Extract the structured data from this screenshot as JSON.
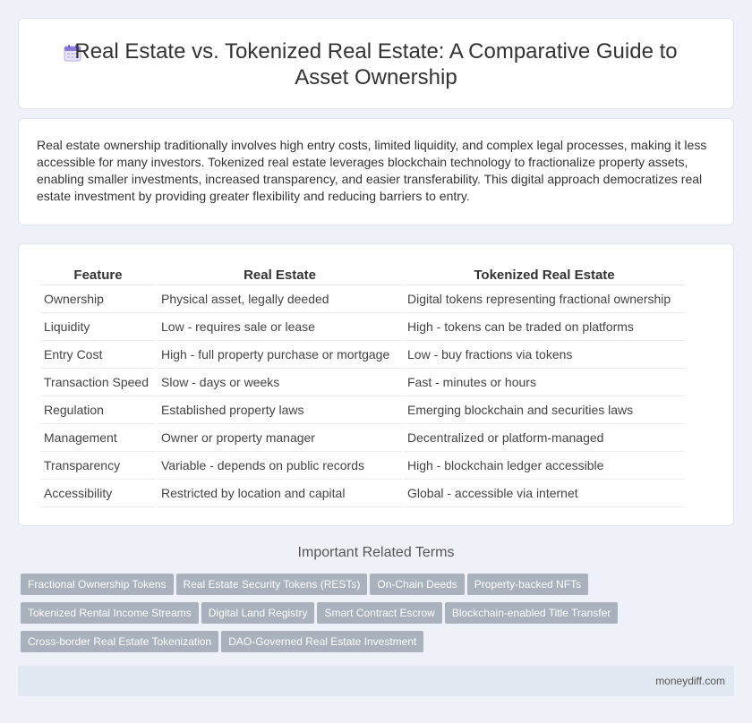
{
  "header": {
    "title": "Real Estate vs. Tokenized Real Estate: A Comparative Guide to Asset Ownership",
    "icon": "calendar-icon"
  },
  "intro": {
    "text": "Real estate ownership traditionally involves high entry costs, limited liquidity, and complex legal processes, making it less accessible for many investors. Tokenized real estate leverages blockchain technology to fractionalize property assets, enabling smaller investments, increased transparency, and easier transferability. This digital approach democratizes real estate investment by providing greater flexibility and reducing barriers to entry."
  },
  "table": {
    "headers": [
      "Feature",
      "Real Estate",
      "Tokenized Real Estate"
    ],
    "rows": [
      [
        "Ownership",
        "Physical asset, legally deeded",
        "Digital tokens representing fractional ownership"
      ],
      [
        "Liquidity",
        "Low - requires sale or lease",
        "High - tokens can be traded on platforms"
      ],
      [
        "Entry Cost",
        "High - full property purchase or mortgage",
        "Low - buy fractions via tokens"
      ],
      [
        "Transaction Speed",
        "Slow - days or weeks",
        "Fast - minutes or hours"
      ],
      [
        "Regulation",
        "Established property laws",
        "Emerging blockchain and securities laws"
      ],
      [
        "Management",
        "Owner or property manager",
        "Decentralized or platform-managed"
      ],
      [
        "Transparency",
        "Variable - depends on public records",
        "High - blockchain ledger accessible"
      ],
      [
        "Accessibility",
        "Restricted by location and capital",
        "Global - accessible via internet"
      ]
    ]
  },
  "related": {
    "title": "Important Related Terms",
    "tags": [
      "Fractional Ownership Tokens",
      "Real Estate Security Tokens (RESTs)",
      "On-Chain Deeds",
      "Property-backed NFTs",
      "Tokenized Rental Income Streams",
      "Digital Land Registry",
      "Smart Contract Escrow",
      "Blockchain-enabled Title Transfer",
      "Cross-border Real Estate Tokenization",
      "DAO-Governed Real Estate Investment"
    ]
  },
  "footer": {
    "site": "moneydiff.com"
  },
  "colors": {
    "background": "#eef2f8",
    "tag": "#a9b1bd",
    "footer": "#e2e8f2"
  }
}
